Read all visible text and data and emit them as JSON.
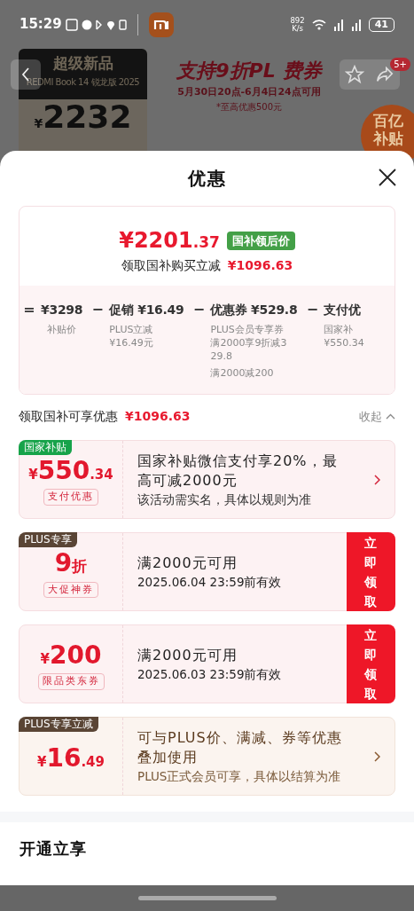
{
  "status_bar": {
    "time": "15:29",
    "net_speed": "892",
    "net_unit": "K/s",
    "battery": "41"
  },
  "background": {
    "product_tag": "超级新品",
    "product_name": "REDMI Book 14 锐龙版 2025",
    "price_symbol": "¥",
    "price": "2232",
    "banner_title": "支持9折PL",
    "banner_title_tail": "费券",
    "banner_dates": "5月30日20点-6月4日24点可用",
    "banner_note": "*至高优惠500元",
    "badge": "5+",
    "corner_tag": [
      "百亿",
      "补贴"
    ]
  },
  "sheet": {
    "title": "优惠",
    "summary": {
      "price_main": "¥2201",
      "price_decimal": ".37",
      "price_tag": "国补领后价",
      "saving_label": "领取国补购买立减",
      "saving_amount": "¥1096.63"
    },
    "breakdown": [
      {
        "operator": "=",
        "amount": "¥3298",
        "notes": [
          "补贴价"
        ]
      },
      {
        "operator": "−",
        "label": "促销",
        "amount": "¥16.49",
        "notes": [
          "PLUS立减",
          "¥16.49元"
        ]
      },
      {
        "operator": "−",
        "label": "优惠券",
        "amount": "¥529.8",
        "notes": [
          "PLUS会员专享券满2000享9折减329.8",
          "满2000减200"
        ]
      },
      {
        "operator": "−",
        "label": "支付优",
        "notes": [
          "国家补",
          "¥550.34"
        ]
      }
    ],
    "discount_header": {
      "label": "领取国补可享优惠",
      "amount": "¥1096.63",
      "toggle": "收起"
    },
    "offers": [
      {
        "kind": "subsidy",
        "tag": {
          "text": "国家补贴",
          "color": "#17a34a"
        },
        "currency": "¥",
        "value": "550",
        "decimal": ".34",
        "sub": "支付优惠",
        "title": "国家补贴微信支付享20%，最高可减2000元",
        "desc": "该活动需实名，具体以规则为准"
      },
      {
        "kind": "coupon",
        "tag": {
          "text": "PLUS专享",
          "color": "#5a4535"
        },
        "value": "9",
        "unit": "折",
        "sub": "大促神券",
        "title": "满2000元可用",
        "desc": "2025.06.04 23:59前有效",
        "button": "立即领取"
      },
      {
        "kind": "coupon",
        "currency": "¥",
        "value": "200",
        "sub": "限品类东券",
        "title": "满2000元可用",
        "desc": "2025.06.03 23:59前有效",
        "button": "立即领取"
      },
      {
        "kind": "plus",
        "tag": {
          "text": "PLUS专享立减",
          "color": "#5a4535"
        },
        "currency": "¥",
        "value": "16",
        "decimal": ".49",
        "title": "可与PLUS价、满减、券等优惠叠加使用",
        "desc": "PLUS正式会员可享，具体以结算为准"
      }
    ],
    "footer_title": "开通立享"
  }
}
